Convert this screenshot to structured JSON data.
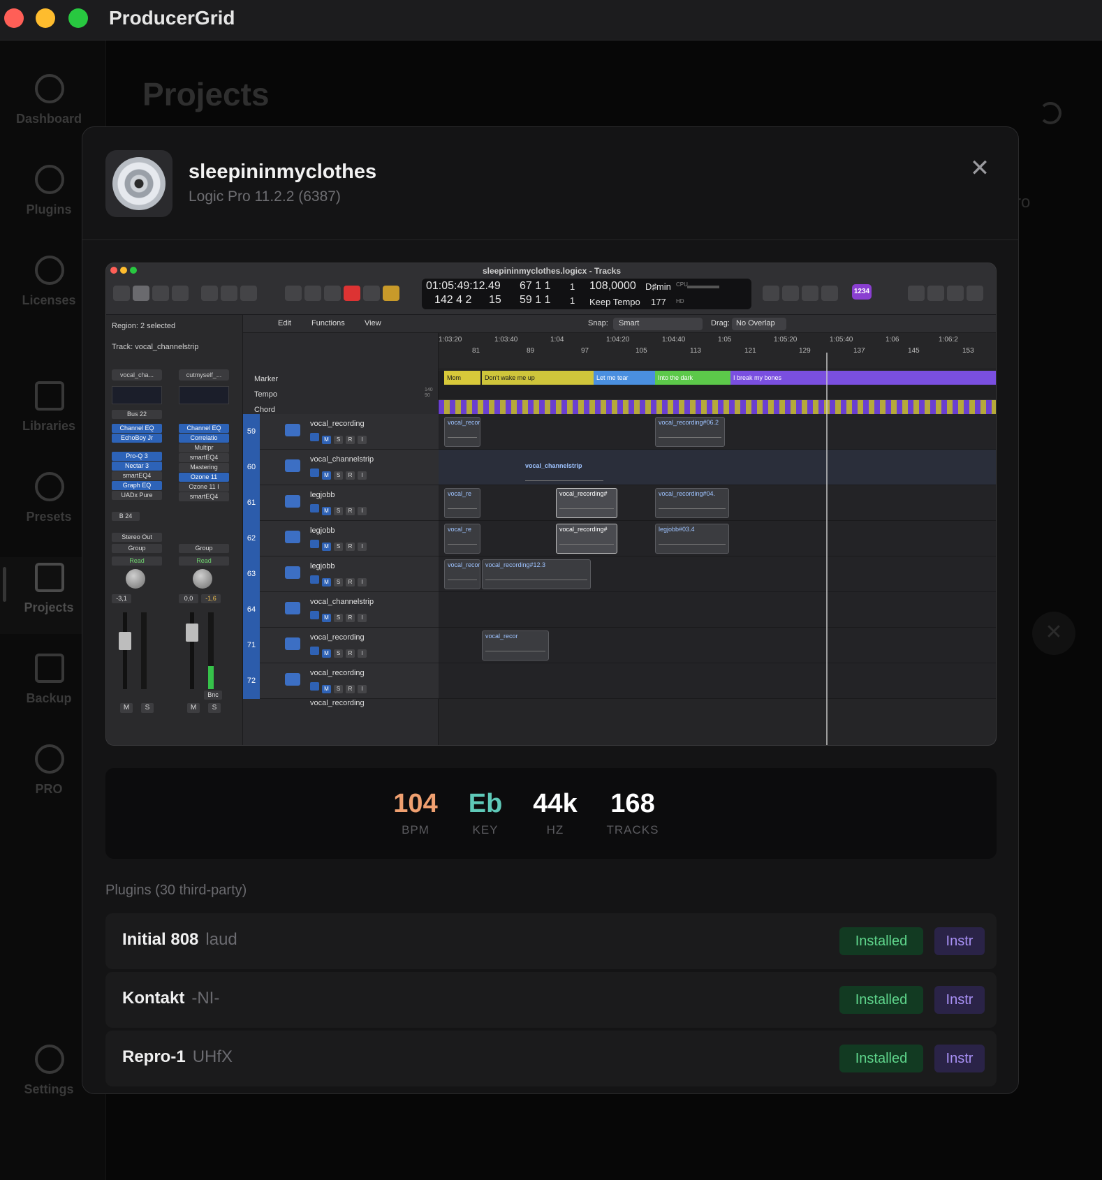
{
  "window": {
    "title": "ProducerGrid"
  },
  "sidebar": {
    "items": [
      {
        "label": "Dashboard",
        "icon": "gauge-icon"
      },
      {
        "label": "Plugins",
        "icon": "plug-icon"
      },
      {
        "label": "Licenses",
        "icon": "key-icon"
      },
      {
        "label": "Libraries",
        "icon": "folder-icon"
      },
      {
        "label": "Presets",
        "icon": "music-note-icon"
      },
      {
        "label": "Projects",
        "icon": "document-icon"
      },
      {
        "label": "Backup",
        "icon": "drive-icon"
      },
      {
        "label": "PRO",
        "icon": "bolt-icon"
      },
      {
        "label": "Settings",
        "icon": "gear-icon"
      }
    ],
    "active": "Projects"
  },
  "background": {
    "page_title": "Projects",
    "partial_text": "ro"
  },
  "modal": {
    "project_name": "sleepininmyclothes",
    "daw_version": "Logic Pro 11.2.2 (6387)",
    "close_glyph": "✕",
    "screenshot": {
      "window_title": "sleepininmyclothes.logicx - Tracks",
      "lcd": {
        "time": "01:05:49:12.49",
        "bars_top": "67  1  1",
        "sub_top": "1",
        "bars_bottom": "142  4  2",
        "sub_bottom": "15",
        "bars_bottom2": "59  1  1",
        "sub_bottom2": "1",
        "tempo": "108,0000",
        "key": "D♯min",
        "tempo_mode": "Keep Tempo",
        "division": "177",
        "cpu_label": "CPU",
        "hd_label": "HD",
        "badge": "1234"
      },
      "inspector": {
        "region": "Region: 2 selected",
        "track": "Track: vocal_channelstrip",
        "strip1": {
          "name": "vocal_cha...",
          "bus": "Bus 22",
          "slots_blue": [
            "Channel EQ",
            "EchoBoy Jr",
            "Pro-Q 3",
            "Nectar 3"
          ],
          "slots_grey": [
            "smartEQ4"
          ],
          "slots_blue2": [
            "Graph EQ"
          ],
          "slots_grey2": [
            "UADx Pure"
          ],
          "send": "B 24",
          "output": "Stereo Out",
          "group": "Group",
          "automation": "Read",
          "pan_value": "-3,1"
        },
        "strip2": {
          "name": "cutmyself_...",
          "slots_blue": [
            "Channel EQ",
            "Correlatio"
          ],
          "slots_grey": [
            "Multipr",
            "smartEQ4",
            "Mastering"
          ],
          "slots_blue2": [
            "Ozone 11"
          ],
          "slots_grey2": [
            "Ozone 11 I",
            "smartEQ4"
          ],
          "group": "Group",
          "automation": "Read",
          "pan_value": "0,0",
          "peak": "-1,6",
          "bounce": "Bnc"
        },
        "mute": "M",
        "solo": "S"
      },
      "toolbar": {
        "edit": "Edit",
        "functions": "Functions",
        "view": "View",
        "snap_label": "Snap:",
        "snap_value": "Smart",
        "drag_label": "Drag:",
        "drag_value": "No Overlap"
      },
      "ruler": {
        "times": [
          "1:03:20",
          "1:03:40",
          "1:04",
          "1:04:20",
          "1:04:40",
          "1:05",
          "1:05:20",
          "1:05:40",
          "1:06",
          "1:06:2"
        ],
        "bars": [
          "81",
          "89",
          "97",
          "105",
          "113",
          "121",
          "129",
          "137",
          "145",
          "153"
        ]
      },
      "global_tracks": {
        "marker": "Marker",
        "tempo": "Tempo",
        "chord": "Chord",
        "tempo_hi": "140",
        "tempo_lo": "90",
        "markers": [
          {
            "label": "Mom",
            "color": "#d8c93a"
          },
          {
            "label": "Don't wake me up",
            "color": "#cfc53b"
          },
          {
            "label": "Let me tear",
            "color": "#4a8fe0"
          },
          {
            "label": "Into the dark",
            "color": "#5cc94a"
          },
          {
            "label": "I break my bones",
            "color": "#7a4fe0"
          }
        ]
      },
      "tracks": [
        {
          "num": "59",
          "name": "vocal_recording",
          "regions": [
            "vocal_recor",
            "vocal_recording#06.2"
          ]
        },
        {
          "num": "60",
          "name": "vocal_channelstrip",
          "regions": [
            "vocal_channelstrip"
          ]
        },
        {
          "num": "61",
          "name": "legjobb",
          "regions": [
            "vocal_re",
            "vocal_recording#",
            "vocal_recording#04."
          ]
        },
        {
          "num": "62",
          "name": "legjobb",
          "regions": [
            "vocal_re",
            "vocal_recording#",
            "legjobb#03.4"
          ]
        },
        {
          "num": "63",
          "name": "legjobb",
          "regions": [
            "vocal_recor",
            "vocal_recording#12.3"
          ]
        },
        {
          "num": "64",
          "name": "vocal_channelstrip",
          "regions": []
        },
        {
          "num": "71",
          "name": "vocal_recording",
          "regions": [
            "vocal_recor"
          ]
        },
        {
          "num": "72",
          "name": "vocal_recording",
          "regions": []
        }
      ],
      "track_buttons": {
        "mute": "M",
        "solo": "S",
        "record": "R",
        "input": "I"
      },
      "last_track_partial": "vocal_recording"
    },
    "stats": [
      {
        "value": "104",
        "key": "BPM",
        "color": "#f0a070"
      },
      {
        "value": "Eb",
        "key": "KEY",
        "color": "#5fc9b8"
      },
      {
        "value": "44k",
        "key": "HZ",
        "color": "#ffffff"
      },
      {
        "value": "168",
        "key": "TRACKS",
        "color": "#ffffff"
      }
    ],
    "plugins_title": "Plugins (30 third-party)",
    "plugins": [
      {
        "name": "Initial 808",
        "vendor": "laud",
        "status": "Installed",
        "kind": "Instr"
      },
      {
        "name": "Kontakt",
        "vendor": "-NI-",
        "status": "Installed",
        "kind": "Instr"
      },
      {
        "name": "Repro-1",
        "vendor": "UHfX",
        "status": "Installed",
        "kind": "Instr"
      }
    ]
  }
}
